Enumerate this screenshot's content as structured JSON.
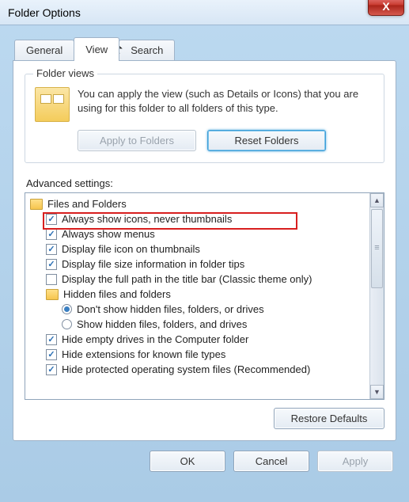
{
  "window": {
    "title": "Folder Options"
  },
  "tabs": {
    "t0": "General",
    "t1": "View",
    "t2": "Search"
  },
  "folder_views": {
    "group_label": "Folder views",
    "text": "You can apply the view (such as Details or Icons) that you are using for this folder to all folders of this type.",
    "apply_btn": "Apply to Folders",
    "reset_btn": "Reset Folders"
  },
  "adv": {
    "label": "Advanced settings:",
    "root": "Files and Folders",
    "i1": "Always show icons, never thumbnails",
    "i2": "Always show menus",
    "i3": "Display file icon on thumbnails",
    "i4": "Display file size information in folder tips",
    "i5": "Display the full path in the title bar (Classic theme only)",
    "hidden_group": "Hidden files and folders",
    "r1": "Don't show hidden files, folders, or drives",
    "r2": "Show hidden files, folders, and drives",
    "i6": "Hide empty drives in the Computer folder",
    "i7": "Hide extensions for known file types",
    "i8": "Hide protected operating system files (Recommended)"
  },
  "buttons": {
    "restore": "Restore Defaults",
    "ok": "OK",
    "cancel": "Cancel",
    "apply": "Apply"
  }
}
